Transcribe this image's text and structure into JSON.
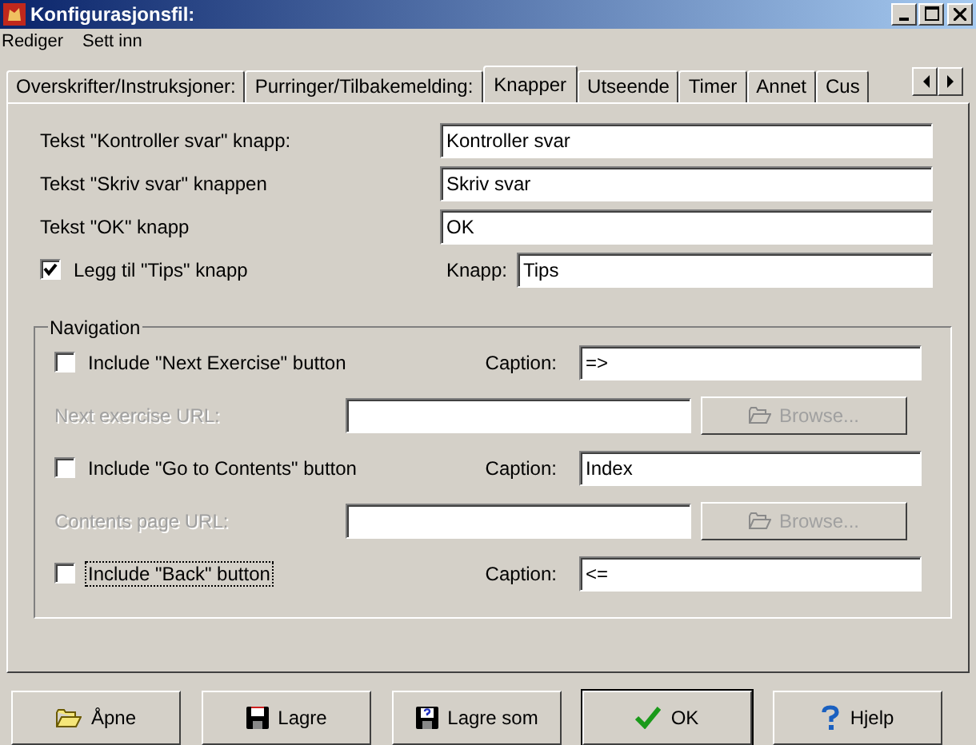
{
  "window": {
    "title": "Konfigurasjonsfil:"
  },
  "menu": [
    {
      "label": "Rediger"
    },
    {
      "label": "Sett inn"
    }
  ],
  "tabs": [
    {
      "label": "Overskrifter/Instruksjoner:",
      "selected": false
    },
    {
      "label": "Purringer/Tilbakemelding:",
      "selected": false
    },
    {
      "label": "Knapper",
      "selected": true
    },
    {
      "label": "Utseende",
      "selected": false
    },
    {
      "label": "Timer",
      "selected": false
    },
    {
      "label": "Annet",
      "selected": false
    },
    {
      "label": "Cus",
      "selected": false
    }
  ],
  "button_texts": [
    {
      "label": "Tekst  \"Kontroller svar\" knapp:",
      "value": "Kontroller svar"
    },
    {
      "label": "Tekst \"Skriv svar\" knappen",
      "value": "Skriv svar"
    },
    {
      "label": "Tekst \"OK\" knapp",
      "value": "OK"
    }
  ],
  "tips": {
    "label": "Legg til \"Tips\" knapp",
    "checked": true,
    "field_label": "Knapp:",
    "value": "Tips"
  },
  "navigation": {
    "title": "Navigation",
    "items": [
      {
        "kind": "checkbox",
        "label": "Include \"Next Exercise\" button",
        "checked": false,
        "focused": false,
        "caption_label": "Caption:",
        "caption": "=>"
      },
      {
        "kind": "url",
        "label": "Next exercise URL:",
        "disabled": true,
        "browse": "Browse..."
      },
      {
        "kind": "checkbox",
        "label": "Include \"Go to Contents\" button",
        "checked": false,
        "focused": false,
        "caption_label": "Caption:",
        "caption": "Index"
      },
      {
        "kind": "url",
        "label": "Contents page URL:",
        "disabled": true,
        "browse": "Browse..."
      },
      {
        "kind": "checkbox",
        "label": "Include \"Back\" button",
        "checked": false,
        "focused": true,
        "caption_label": "Caption:",
        "caption": "<="
      }
    ]
  },
  "footer_buttons": [
    {
      "kind": "open",
      "label": "Åpne"
    },
    {
      "kind": "save",
      "label": "Lagre"
    },
    {
      "kind": "save_as",
      "label": "Lagre som"
    },
    {
      "kind": "ok",
      "label": "OK"
    },
    {
      "kind": "help",
      "label": "Hjelp"
    }
  ]
}
